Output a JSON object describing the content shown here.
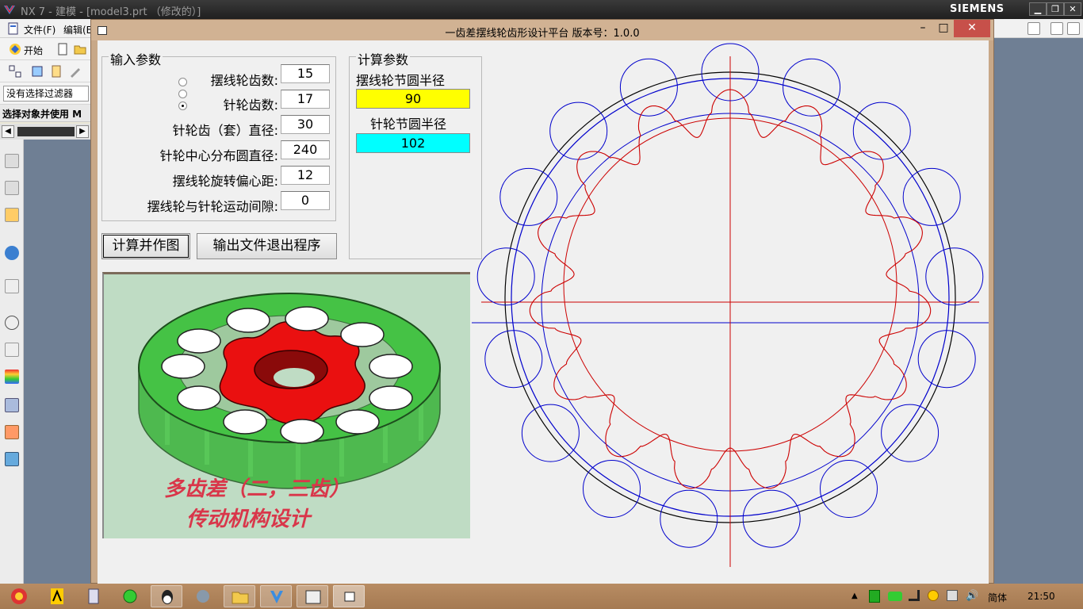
{
  "nx": {
    "window_title": "NX 7 - 建模 - [model3.prt （修改的）]",
    "brand": "SIEMENS",
    "menu": [
      "文件(F)",
      "编辑(E"
    ],
    "start_label": "开始",
    "filter_placeholder": "没有选择过滤器",
    "select_scope_label": "选择对象并使用  M"
  },
  "dialog": {
    "title": "一齿差摆线轮齿形设计平台  版本号：1.0.0",
    "input_group": {
      "legend": "输入参数",
      "params": [
        {
          "label": "摆线轮齿数:",
          "value": "15"
        },
        {
          "label": "针轮齿数:",
          "value": "17"
        },
        {
          "label": "针轮齿（套）直径:",
          "value": "30"
        },
        {
          "label": "针轮中心分布圆直径:",
          "value": "240"
        },
        {
          "label": "摆线轮旋转偏心距:",
          "value": "12"
        },
        {
          "label": "摆线轮与针轮运动间隙:",
          "value": "0"
        }
      ],
      "radio_selected_index": 1
    },
    "calc_group": {
      "legend": "计算参数",
      "cycloid_label": "摆线轮节圆半径",
      "cycloid_value": "90",
      "cycloid_color": "#ffff00",
      "pin_label": "针轮节圆半径",
      "pin_value": "102",
      "pin_color": "#00ffff"
    },
    "buttons": {
      "calc": "计算并作图",
      "export": "输出文件退出程序"
    },
    "picture": {
      "caption_line1": "多齿差（二，三齿）",
      "caption_line2": "传动机构设计"
    },
    "drawing": {
      "pin_count": 17,
      "lobe_count": 15,
      "pin_color": "#0000cc",
      "cycloid_color": "#cc0000",
      "outer_circle_color": "#000000"
    }
  },
  "taskbar": {
    "ime": "简体",
    "time": "21:50"
  }
}
